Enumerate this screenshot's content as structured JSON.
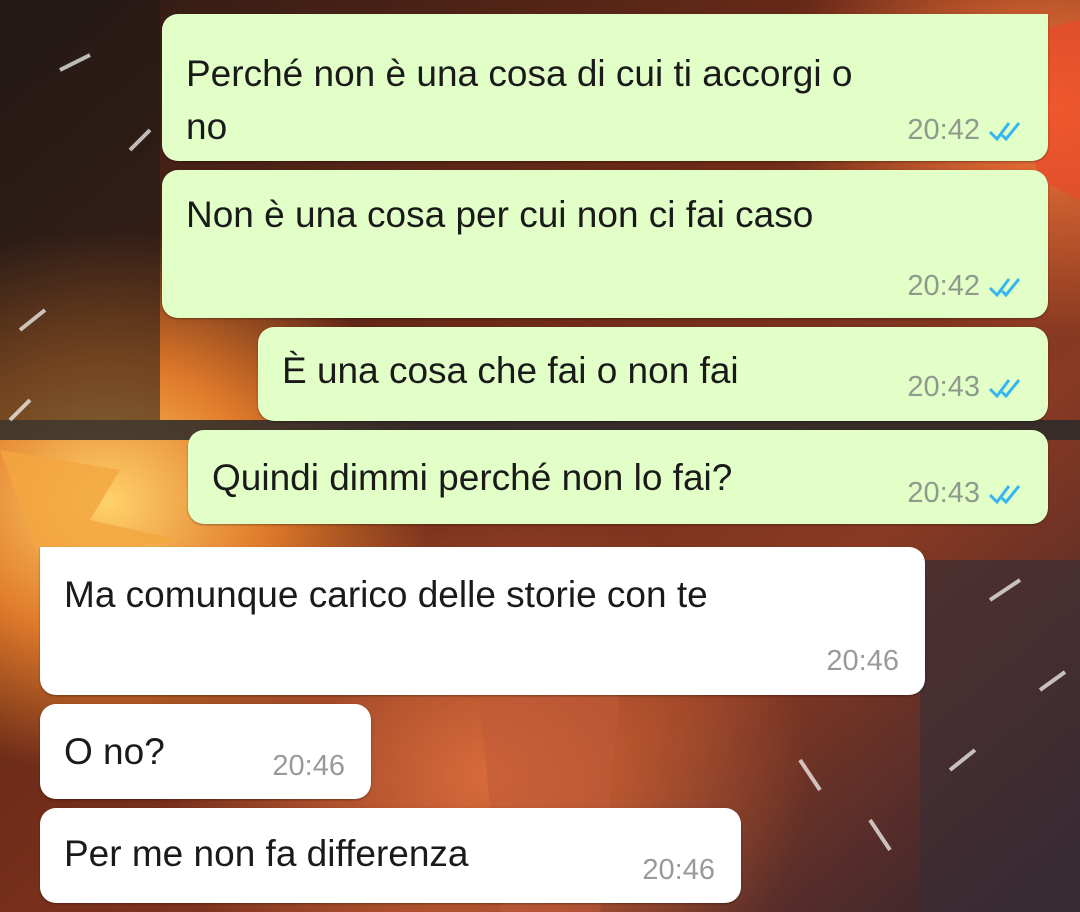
{
  "chat": {
    "messages": [
      {
        "direction": "outgoing",
        "text_lines": [
          "Perché non è una cosa di cui ti accorgi o",
          "no"
        ],
        "time": "20:42",
        "status": "read-double-check-icon"
      },
      {
        "direction": "outgoing",
        "text_lines": [
          "Non è una cosa per cui non ci fai caso"
        ],
        "time": "20:42",
        "status": "read-double-check-icon"
      },
      {
        "direction": "outgoing",
        "text_lines": [
          "È una cosa che fai o non fai"
        ],
        "time": "20:43",
        "status": "read-double-check-icon"
      },
      {
        "direction": "outgoing",
        "text_lines": [
          "Quindi dimmi perché non lo fai?"
        ],
        "time": "20:43",
        "status": "read-double-check-icon"
      },
      {
        "direction": "incoming",
        "text_lines": [
          "Ma comunque carico delle storie con te"
        ],
        "time": "20:46"
      },
      {
        "direction": "incoming",
        "text_lines": [
          "O no?"
        ],
        "time": "20:46"
      },
      {
        "direction": "incoming",
        "text_lines": [
          "Per me non fa differenza"
        ],
        "time": "20:46"
      }
    ]
  },
  "colors": {
    "outgoing_bubble": "#e2ffc8",
    "incoming_bubble": "#ffffff",
    "read_tick": "#34b7f1",
    "timestamp": "#8f9a8c"
  }
}
